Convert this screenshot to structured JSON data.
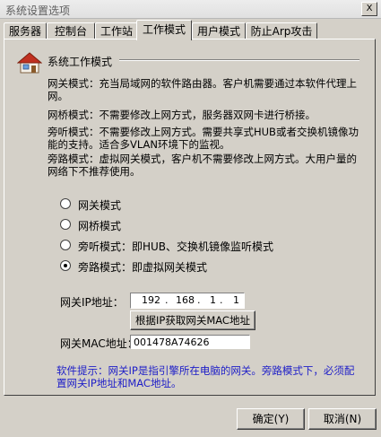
{
  "window": {
    "title": "系统设置选项",
    "close_label": "X"
  },
  "tabs": [
    {
      "label": "服务器"
    },
    {
      "label": "控制台"
    },
    {
      "label": "工作站"
    },
    {
      "label": "工作模式"
    },
    {
      "label": "用户模式"
    },
    {
      "label": "防止Arp攻击"
    }
  ],
  "active_tab": "工作模式",
  "section": {
    "title": "系统工作模式",
    "icon": "house-icon"
  },
  "descriptions": [
    "网关模式：充当局域网的软件路由器。客户机需要通过本软件代理上网。",
    "网桥模式：不需要修改上网方式，服务器双网卡进行桥接。",
    "旁听模式：不需要修改上网方式。需要共享式HUB或者交换机镜像功能的支持。适合多VLAN环境下的监视。",
    "旁路模式：虚拟网关模式，客户机不需要修改上网方式。大用户量的网络下不推荐使用。"
  ],
  "modes": [
    {
      "label": "网关模式",
      "checked": false
    },
    {
      "label": "网桥模式",
      "checked": false
    },
    {
      "label": "旁听模式：即HUB、交换机镜像监听模式",
      "checked": false
    },
    {
      "label": "旁路模式：即虚拟网关模式",
      "checked": true
    }
  ],
  "gateway": {
    "ip_label": "网关IP地址：",
    "ip_octets": [
      "192",
      "168",
      "1",
      "1"
    ],
    "ip_dot": ".",
    "get_mac_button": "根据IP获取网关MAC地址",
    "mac_label": "网关MAC地址：",
    "mac_value": "001478A74626"
  },
  "tip": "软件提示：网关IP是指引擎所在电脑的网关。旁路模式下，必须配置网关IP地址和MAC地址。",
  "footer": {
    "ok_label": "确定(Y)",
    "cancel_label": "取消(N)"
  }
}
